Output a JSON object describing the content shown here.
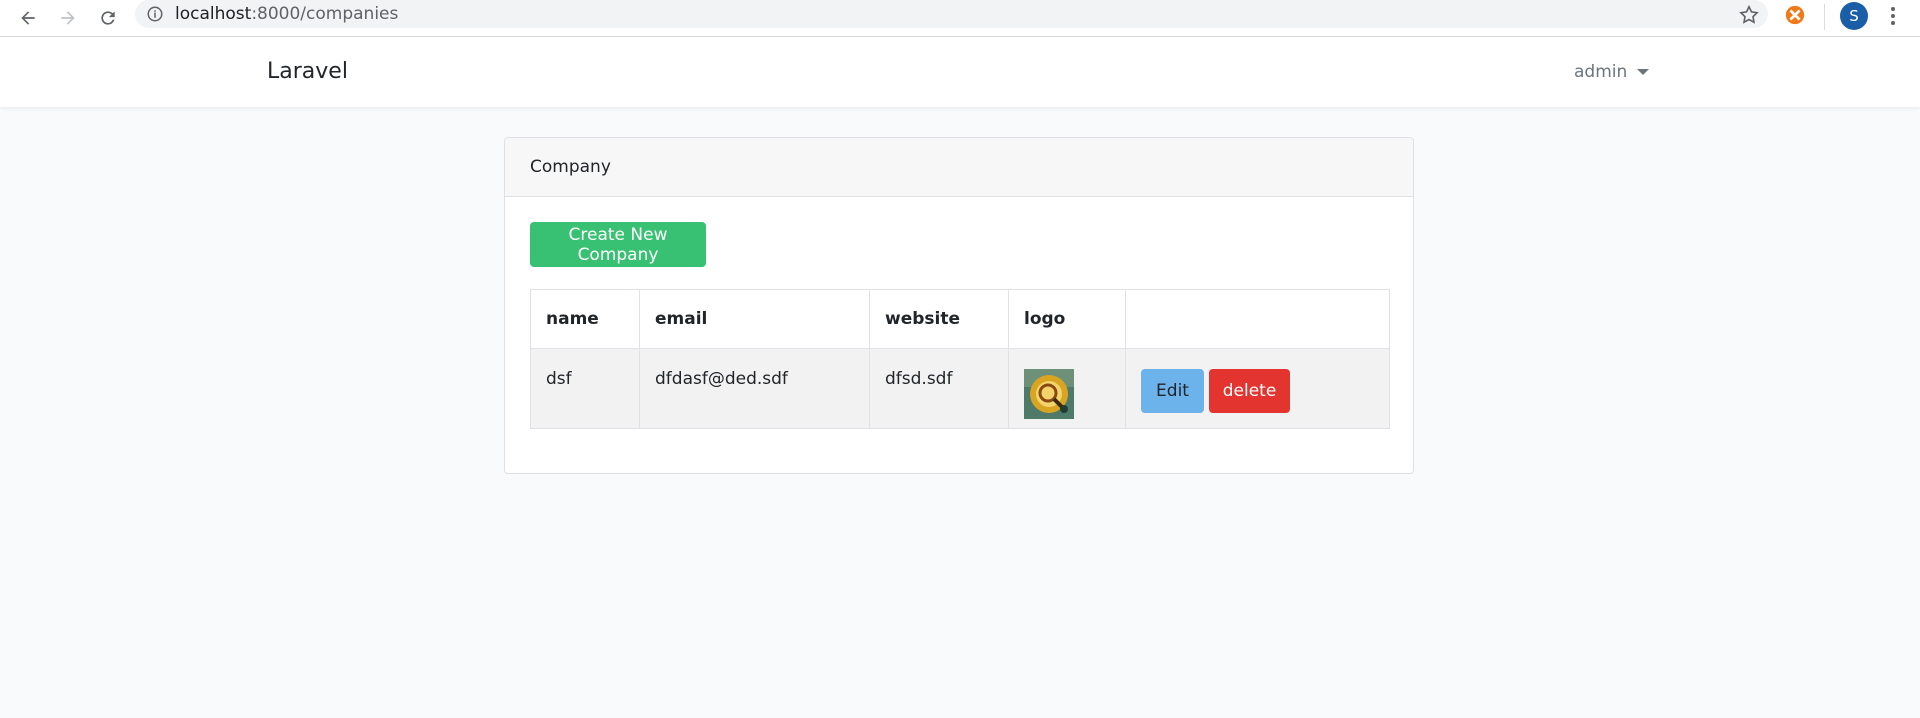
{
  "browser": {
    "url_host": "localhost",
    "url_path": ":8000/companies",
    "profile_initial": "S"
  },
  "navbar": {
    "brand": "Laravel",
    "user": "admin"
  },
  "card": {
    "title": "Company",
    "create_label": "Create New Company",
    "columns": [
      "name",
      "email",
      "website",
      "logo",
      ""
    ],
    "rows": [
      {
        "name": "dsf",
        "email": "dfdasf@ded.sdf",
        "website": "dfsd.sdf",
        "edit_label": "Edit",
        "delete_label": "delete"
      }
    ]
  },
  "colors": {
    "create": "#38c172",
    "edit": "#6cb2eb",
    "delete": "#e3342f",
    "avatar": "#1a5ea8"
  }
}
